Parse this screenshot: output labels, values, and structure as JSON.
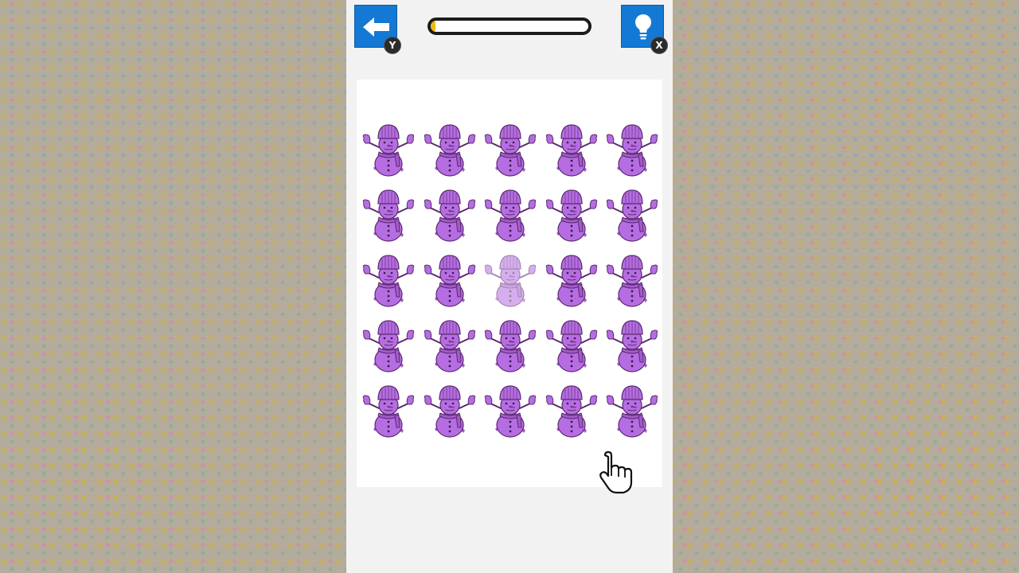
{
  "header": {
    "back_button": {
      "icon": "arrow-left-icon",
      "controller_key": "Y"
    },
    "hint_button": {
      "icon": "lightbulb-icon",
      "controller_key": "X"
    },
    "progress": {
      "value": 0.03
    }
  },
  "board": {
    "rows": 5,
    "cols": 5,
    "sprite": "snowman-icon",
    "odd_one_out": {
      "row": 3,
      "col": 3
    }
  },
  "colors": {
    "accent": "#1479d4",
    "progress_fill": "#f2b70f",
    "snowman_fill": "#b66de2",
    "snowman_outline": "#5a2a70"
  },
  "cursor": {
    "icon": "hand-pointer-icon"
  }
}
